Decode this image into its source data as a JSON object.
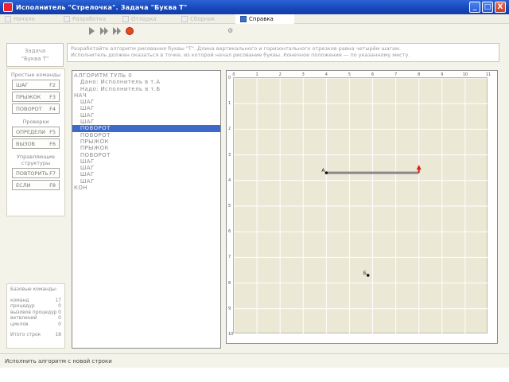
{
  "window": {
    "title": "Исполнитель \"Стрелочка\". Задача \"Буква Т\"",
    "controls": [
      "_",
      "□",
      "X"
    ]
  },
  "menu": {
    "items": [
      {
        "label": "Начало",
        "active": false
      },
      {
        "label": "Разработка",
        "active": false
      },
      {
        "label": "Отладка",
        "active": false
      },
      {
        "label": "Сборник",
        "active": false
      },
      {
        "label": "Справка",
        "active": true
      }
    ]
  },
  "task": {
    "name_label": "Задача",
    "name_value": "\"Буква Т\"",
    "description_line1": "Разработайте алгоритм рисования буквы \"Т\". Длина вертикального и горизонтального отрезков равна четырём шагам.",
    "description_line2": "Исполнитель должен оказаться в точке, из которой начал рисование буквы. Конечное положение — по указанному месту."
  },
  "commands": {
    "heading_simple": "Простые команды",
    "buttons_simple": [
      {
        "label": "ШАГ",
        "key": "F2"
      },
      {
        "label": "ПРЫЖОК",
        "key": "F3"
      },
      {
        "label": "ПОВОРОТ",
        "key": "F4"
      }
    ],
    "heading_conditions": "Проверки",
    "buttons_conditions": [
      {
        "label": "ОПРЕДЕЛИ",
        "key": "F5"
      },
      {
        "label": "ВЫЗОВ",
        "key": "F6"
      }
    ],
    "heading_control": "Управляющие структуры",
    "buttons_control": [
      {
        "label": "ПОВТОРИТЬ",
        "key": "F7"
      },
      {
        "label": "ЕСЛИ",
        "key": "F8"
      }
    ]
  },
  "stats": {
    "title": "Базовые команды:",
    "rows": [
      {
        "label": "команд",
        "value": "17"
      },
      {
        "label": "процедур",
        "value": "0"
      },
      {
        "label": "вызовов процедур",
        "value": "0"
      },
      {
        "label": "ветвлений",
        "value": "0"
      },
      {
        "label": "циклов",
        "value": "0"
      }
    ],
    "total_label": "Итого строк",
    "total_value": "18"
  },
  "editor": {
    "lines": [
      "АЛГОРИТМ ТУЛЬ 0",
      "   Дано: Исполнитель в т.А",
      "   Надо: Исполнитель в т.Б",
      "НАЧ",
      "   ШАГ",
      "   ШАГ",
      "   ШАГ",
      "   ШАГ",
      "   ПОВОРОТ",
      "   ПОВОРОТ",
      "   ПРЫЖОК",
      "   ПРЫЖОК",
      "   ПОВОРОТ",
      "   ШАГ",
      "   ШАГ",
      "   ШАГ",
      "   ШАГ",
      "КОН"
    ],
    "selected_line": 8
  },
  "field": {
    "x_ticks": [
      "0",
      "1",
      "2",
      "3",
      "4",
      "5",
      "6",
      "7",
      "8",
      "9",
      "10",
      "11"
    ],
    "y_ticks": [
      "0",
      "1",
      "2",
      "3",
      "4",
      "5",
      "6",
      "7",
      "8",
      "9",
      "10"
    ],
    "point_a_label": "А",
    "point_b_label": "Б",
    "line_color": "#888888",
    "arrow_color": "#e02010"
  },
  "status": {
    "text": "Исполнить алгоритм с новой строки"
  }
}
